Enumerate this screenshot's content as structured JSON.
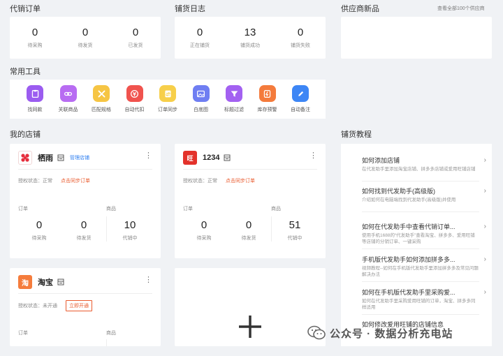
{
  "sections": {
    "agency_orders": "代销订单",
    "listing_log": "铺货日志",
    "supplier_new": "供应商新品",
    "view_all_suppliers": "查看全部100个供应商",
    "common_tools": "常用工具",
    "my_shops": "我的店铺",
    "tutorials": "铺货教程"
  },
  "agency_orders": [
    {
      "num": "0",
      "label": "待采购"
    },
    {
      "num": "0",
      "label": "待发货"
    },
    {
      "num": "0",
      "label": "已发货"
    }
  ],
  "listing_log": [
    {
      "num": "0",
      "label": "正在铺货"
    },
    {
      "num": "13",
      "label": "铺货成功"
    },
    {
      "num": "0",
      "label": "铺货失败"
    }
  ],
  "tools": [
    {
      "label": "找同款",
      "color": "#9b5cf0",
      "icon": "find-same-icon"
    },
    {
      "label": "关联商品",
      "color": "#b86cf2",
      "icon": "link-icon"
    },
    {
      "label": "匹配规格",
      "color": "#f6c544",
      "icon": "match-spec-icon"
    },
    {
      "label": "自动代扣",
      "color": "#f0534e",
      "icon": "auto-deduct-icon"
    },
    {
      "label": "订单同步",
      "color": "#f7cf4a",
      "icon": "order-sync-icon"
    },
    {
      "label": "白底图",
      "color": "#6f7ef2",
      "icon": "image-icon"
    },
    {
      "label": "标题过滤",
      "color": "#a361f1",
      "icon": "filter-icon"
    },
    {
      "label": "库存预警",
      "color": "#f47b3c",
      "icon": "stock-alert-icon"
    },
    {
      "label": "自动备注",
      "color": "#3d86f5",
      "icon": "note-icon"
    }
  ],
  "shops": [
    {
      "name": "栖雨",
      "manage": "管理店铺",
      "auth_prefix": "授权状态：",
      "auth_status": "正常",
      "sync_link": "点击同步订单",
      "orders_label": "订单",
      "goods_label": "商品",
      "stats": [
        {
          "num": "0",
          "label": "待采购"
        },
        {
          "num": "0",
          "label": "待发货"
        },
        {
          "num": "10",
          "label": "代销中"
        }
      ]
    },
    {
      "name": "1234",
      "auth_prefix": "授权状态：",
      "auth_status": "正常",
      "sync_link": "点击同步订单",
      "orders_label": "订单",
      "goods_label": "商品",
      "logo_text": "旺",
      "stats": [
        {
          "num": "0",
          "label": "待采购"
        },
        {
          "num": "0",
          "label": "待发货"
        },
        {
          "num": "51",
          "label": "代销中"
        }
      ]
    },
    {
      "name": "淘宝",
      "auth_prefix": "授权状态：",
      "auth_status": "未开通",
      "open_button": "立即开通",
      "orders_label": "订单",
      "goods_label": "商品",
      "logo_text": "淘"
    }
  ],
  "tutorial_items": [
    {
      "title": "如何添加店铺",
      "desc": "在代发助手里添加淘宝店铺、拼多多店铺或爱用旺铺店铺"
    },
    {
      "title": "如何找到代发助手(高级版)",
      "desc": "介绍如何在电脑端找到代发助手(高级版)并使用"
    },
    {
      "title": "如何在代发助手中查看代销订单...",
      "desc": "使用手机1688的“代发助手”查看淘宝、拼多多、爱用旺铺等店铺的分销订单、一键采购"
    },
    {
      "title": "手机版代发助手如何添加拼多多...",
      "desc": "视频教程--如何在手机版代发助手里添加拼多多及常见问题解决办法"
    },
    {
      "title": "如何在手机版代发助手里采购爱...",
      "desc": "如何在代发助手里采购爱用旺铺的订单，淘宝、拼多多同样适用"
    },
    {
      "title": "如何修改爱用旺铺的店铺信息",
      "desc": ""
    }
  ],
  "watermark": "公众号 · 数据分析充电站"
}
